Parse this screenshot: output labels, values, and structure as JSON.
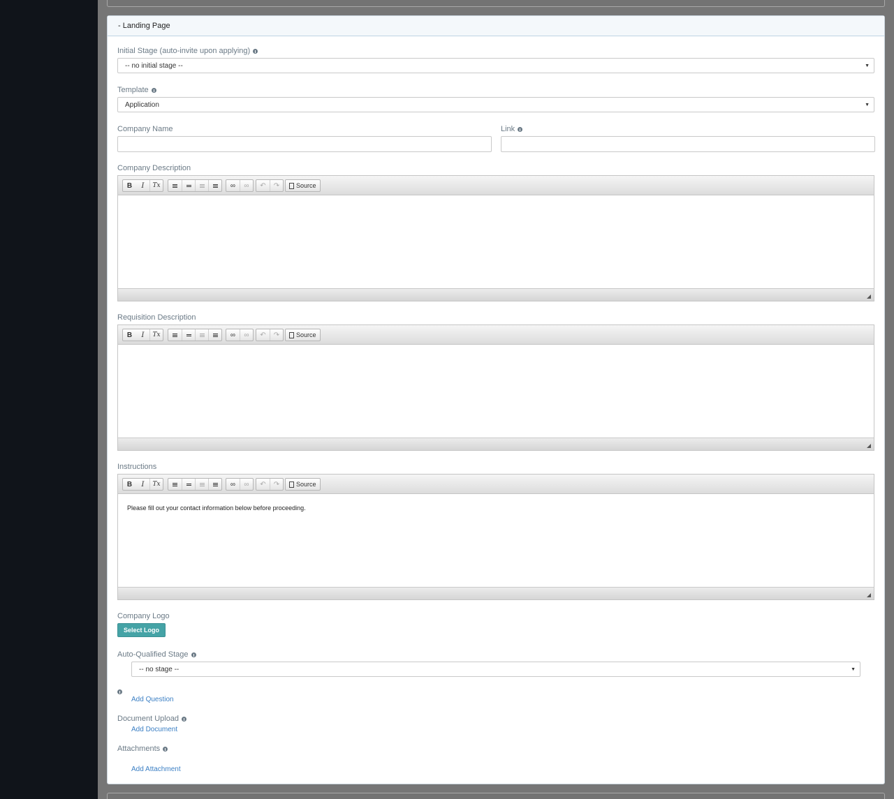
{
  "section": {
    "heading": "- Landing Page"
  },
  "initial_stage": {
    "label": "Initial Stage (auto-invite upon applying)",
    "selected": "-- no initial stage --"
  },
  "template": {
    "label": "Template",
    "selected": "Application"
  },
  "company_name": {
    "label": "Company Name",
    "value": ""
  },
  "link": {
    "label": "Link",
    "value": ""
  },
  "toolbar": {
    "bold": "B",
    "italic": "I",
    "remove_format": "Tx",
    "source": "Source"
  },
  "editors": {
    "company_description": {
      "label": "Company Description",
      "content": ""
    },
    "requisition_description": {
      "label": "Requisition Description",
      "content": ""
    },
    "instructions": {
      "label": "Instructions",
      "content": "Please fill out your contact information below before proceeding."
    }
  },
  "company_logo": {
    "label": "Company Logo",
    "button": "Select Logo"
  },
  "auto_qualified_stage": {
    "label": "Auto-Qualified Stage",
    "selected": "-- no stage --"
  },
  "questions": {
    "add": "Add Question"
  },
  "document_upload": {
    "label": "Document Upload",
    "add": "Add Document"
  },
  "attachments": {
    "label": "Attachments",
    "add": "Add Attachment"
  },
  "icons": {
    "info": "info-icon",
    "select_caret": "caret-down-icon",
    "editor": [
      "bold-icon",
      "italic-icon",
      "remove-format-icon",
      "numbered-list-icon",
      "bulleted-list-icon",
      "outdent-icon",
      "indent-icon",
      "link-icon",
      "unlink-icon",
      "undo-icon",
      "redo-icon",
      "source-icon",
      "resize-icon"
    ]
  },
  "colors": {
    "accent_button": "#45a3a6",
    "link": "#3b7fc4",
    "sidebar": "#10141a"
  }
}
